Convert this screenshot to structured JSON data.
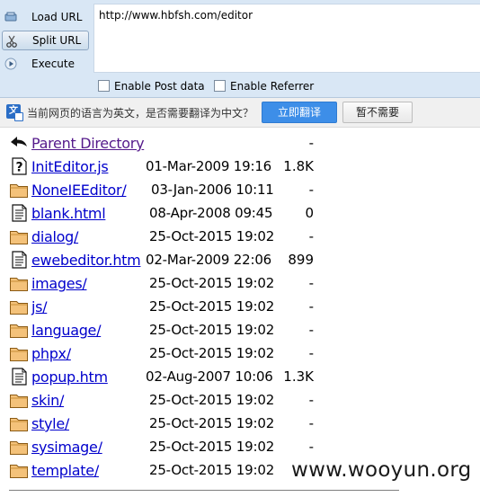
{
  "hackbar": {
    "load_url_label": "Load URL",
    "split_url_label": "Split URL",
    "execute_label": "Execute",
    "url_value": "http://www.hbfsh.com/editor",
    "enable_post_label": "Enable Post data",
    "enable_referrer_label": "Enable Referrer"
  },
  "translate_bar": {
    "message": "当前网页的语言为英文，是否需要翻译为中文？",
    "translate_button": "立即翻译",
    "dismiss_button": "暂不需要"
  },
  "listing": {
    "parent": {
      "name": "Parent Directory",
      "date": "",
      "size": "-"
    },
    "entries": [
      {
        "name": "InitEditor.js",
        "date": "01-Mar-2009 19:16",
        "size": "1.8K",
        "type": "unknown"
      },
      {
        "name": "NoneIEEditor/",
        "date": "03-Jan-2006 10:11",
        "size": "-",
        "type": "folder"
      },
      {
        "name": "blank.html",
        "date": "08-Apr-2008 09:45",
        "size": "0",
        "type": "text"
      },
      {
        "name": "dialog/",
        "date": "25-Oct-2015 19:02",
        "size": "-",
        "type": "folder"
      },
      {
        "name": "ewebeditor.htm",
        "date": "02-Mar-2009 22:06",
        "size": "899",
        "type": "text"
      },
      {
        "name": "images/",
        "date": "25-Oct-2015 19:02",
        "size": "-",
        "type": "folder"
      },
      {
        "name": "js/",
        "date": "25-Oct-2015 19:02",
        "size": "-",
        "type": "folder"
      },
      {
        "name": "language/",
        "date": "25-Oct-2015 19:02",
        "size": "-",
        "type": "folder"
      },
      {
        "name": "phpx/",
        "date": "25-Oct-2015 19:02",
        "size": "-",
        "type": "folder"
      },
      {
        "name": "popup.htm",
        "date": "02-Aug-2007 10:06",
        "size": "1.3K",
        "type": "text"
      },
      {
        "name": "skin/",
        "date": "25-Oct-2015 19:02",
        "size": "-",
        "type": "folder"
      },
      {
        "name": "style/",
        "date": "25-Oct-2015 19:02",
        "size": "-",
        "type": "folder"
      },
      {
        "name": "sysimage/",
        "date": "25-Oct-2015 19:02",
        "size": "-",
        "type": "folder"
      },
      {
        "name": "template/",
        "date": "25-Oct-2015 19:02",
        "size": "",
        "type": "folder"
      }
    ]
  },
  "watermark": "www.wooyun.org",
  "colors": {
    "link": "#0000cc",
    "visited_link": "#551a8b",
    "hackbar_bg": "#d9e7f5",
    "translate_button_bg": "#3d8ee8",
    "folder_fill": "#f4c27a"
  }
}
